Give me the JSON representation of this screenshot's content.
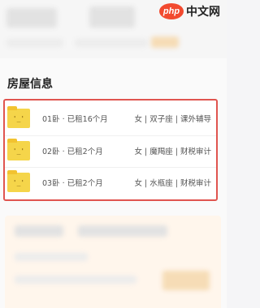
{
  "watermark": {
    "logo": "php",
    "text": "中文网"
  },
  "section": {
    "title": "房屋信息"
  },
  "rooms": [
    {
      "name": "01卧 · 已租16个月",
      "tenant": "女 | 双子座 | 课外辅导",
      "icon_face": "'_'"
    },
    {
      "name": "02卧 · 已租2个月",
      "tenant": "女 | 魔羯座 | 财税审计",
      "icon_face": "'_'"
    },
    {
      "name": "03卧 · 已租2个月",
      "tenant": "女 | 水瓶座 | 财税审计",
      "icon_face": "'_'"
    }
  ],
  "colors": {
    "highlight_border": "#e0554f",
    "room_icon": "#f5d54a",
    "accent_orange": "#f6dcb6"
  }
}
